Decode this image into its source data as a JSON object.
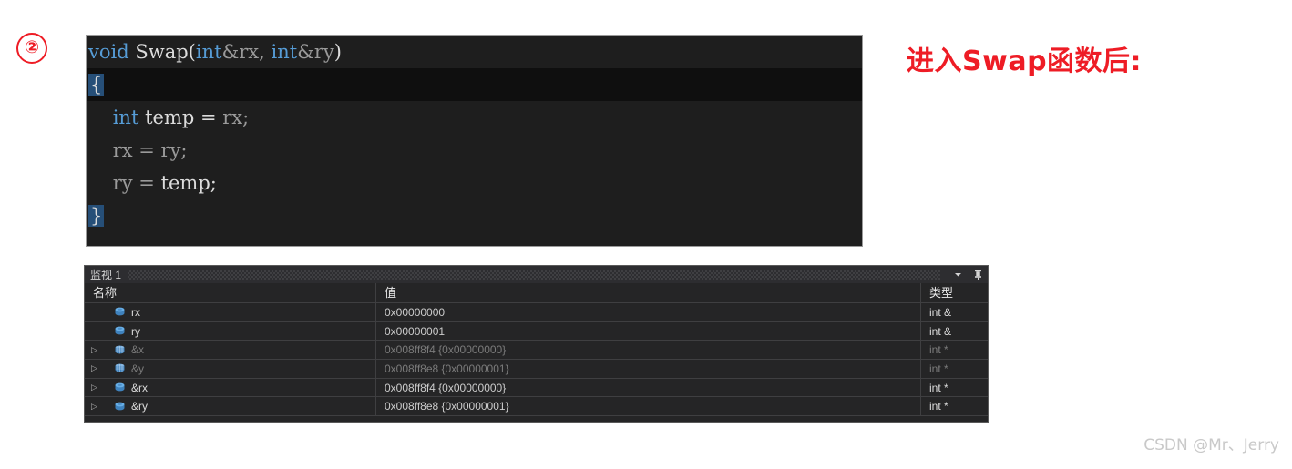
{
  "step_marker": "②",
  "annotation": {
    "title": "进入Swap函数后:",
    "color": "#ee1c25"
  },
  "code_panel": {
    "language": "cpp",
    "lines": [
      {
        "tokens": [
          {
            "text": "void ",
            "kind": "keyword"
          },
          {
            "text": "Swap",
            "kind": "function"
          },
          {
            "text": "(",
            "kind": "punct"
          },
          {
            "text": "int",
            "kind": "keyword"
          },
          {
            "text": "&rx, ",
            "kind": "plain"
          },
          {
            "text": "int",
            "kind": "keyword"
          },
          {
            "text": "&ry",
            "kind": "plain"
          },
          {
            "text": ")",
            "kind": "punct"
          }
        ],
        "current": false
      },
      {
        "tokens": [
          {
            "text": "{",
            "kind": "brace-match"
          }
        ],
        "current": true
      },
      {
        "tokens": [
          {
            "text": "    ",
            "kind": "plain"
          },
          {
            "text": "int",
            "kind": "keyword"
          },
          {
            "text": " ",
            "kind": "plain"
          },
          {
            "text": "temp",
            "kind": "bright"
          },
          {
            "text": " = ",
            "kind": "bright"
          },
          {
            "text": "rx;",
            "kind": "plain"
          }
        ],
        "current": false
      },
      {
        "tokens": [
          {
            "text": "    ",
            "kind": "plain"
          },
          {
            "text": "rx = ry;",
            "kind": "plain"
          }
        ],
        "current": false
      },
      {
        "tokens": [
          {
            "text": "    ",
            "kind": "plain"
          },
          {
            "text": "ry",
            "kind": "plain"
          },
          {
            "text": " = ",
            "kind": "plain"
          },
          {
            "text": "temp;",
            "kind": "bright"
          }
        ],
        "current": false
      },
      {
        "tokens": [
          {
            "text": "}",
            "kind": "brace-match"
          }
        ],
        "current": false
      }
    ]
  },
  "watch_window": {
    "title": "监视 1",
    "dropdown_icon": "chevron-down-icon",
    "pin_icon": "pin-icon",
    "columns": [
      "名称",
      "值",
      "类型"
    ],
    "rows": [
      {
        "expandable": false,
        "icon": "variable-icon",
        "name": "rx",
        "value": "0x00000000",
        "type": "int &",
        "dim": false,
        "refresh": false
      },
      {
        "expandable": false,
        "icon": "variable-icon",
        "name": "ry",
        "value": "0x00000001",
        "type": "int &",
        "dim": false,
        "refresh": false
      },
      {
        "expandable": true,
        "icon": "variable-grid-icon",
        "name": "&x",
        "value": "0x008ff8f4 {0x00000000}",
        "type": "int *",
        "dim": true,
        "refresh": true
      },
      {
        "expandable": true,
        "icon": "variable-grid-icon",
        "name": "&y",
        "value": "0x008ff8e8 {0x00000001}",
        "type": "int *",
        "dim": true,
        "refresh": true
      },
      {
        "expandable": true,
        "icon": "variable-icon",
        "name": "&rx",
        "value": "0x008ff8f4 {0x00000000}",
        "type": "int *",
        "dim": false,
        "refresh": false
      },
      {
        "expandable": true,
        "icon": "variable-icon",
        "name": "&ry",
        "value": "0x008ff8e8 {0x00000001}",
        "type": "int *",
        "dim": false,
        "refresh": false
      }
    ]
  },
  "watermark": "CSDN @Mr、Jerry"
}
